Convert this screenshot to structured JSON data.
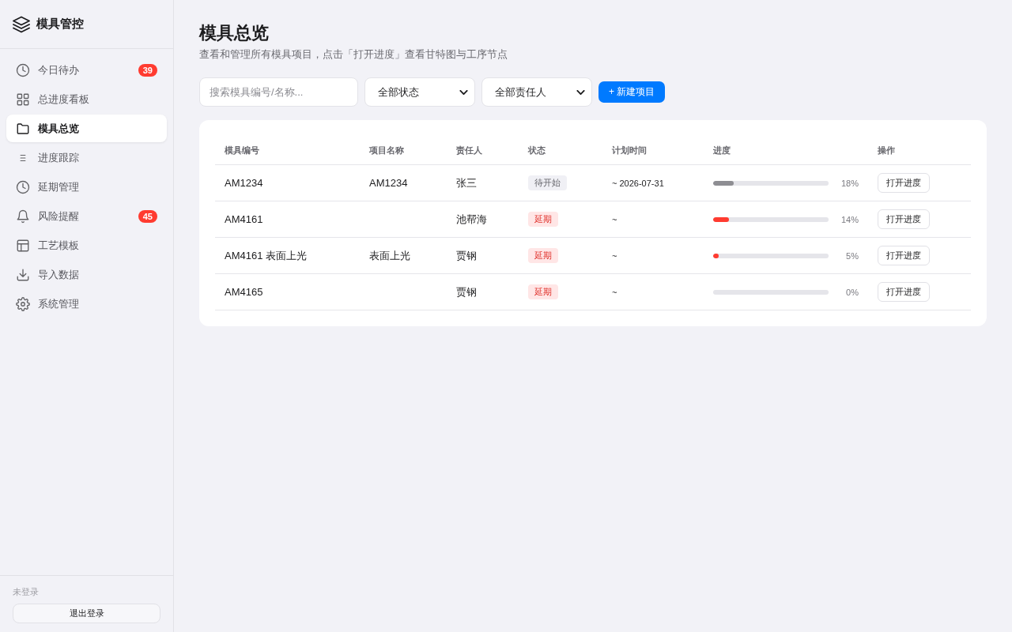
{
  "sidebar": {
    "logo": "模具管控",
    "items": [
      {
        "label": "今日待办",
        "selected": false,
        "badge": "39"
      },
      {
        "label": "总进度看板",
        "selected": false
      },
      {
        "label": "模具总览",
        "selected": true
      },
      {
        "label": "进度跟踪",
        "selected": false
      },
      {
        "label": "延期管理",
        "selected": false
      },
      {
        "label": "风险提醒",
        "selected": false,
        "badge": "45"
      },
      {
        "label": "工艺模板",
        "selected": false
      },
      {
        "label": "导入数据",
        "selected": false
      },
      {
        "label": "系统管理",
        "selected": false
      }
    ],
    "footer": {
      "user_status": "未登录",
      "logout_button": "退出登录"
    }
  },
  "page": {
    "title": "模具总览",
    "subtitle": "查看和管理所有模具项目，点击「打开进度」查看甘特图与工序节点"
  },
  "toolbar": {
    "search": {
      "placeholder": "搜索模具编号/名称..."
    },
    "filters": [
      {
        "value": "全部状态"
      },
      {
        "value": "全部责任人"
      }
    ],
    "new_button": "+ 新建项目"
  },
  "table": {
    "columns": [
      "模具编号",
      "项目名称",
      "责任人",
      "状态",
      "计划时间",
      "进度",
      "操作"
    ],
    "rows": [
      {
        "mold_no": "AM1234",
        "project_name": "AM1234",
        "owner": "张三",
        "status": {
          "label": "待开始",
          "kind": "pending"
        },
        "plan_time": "~ 2026-07-31",
        "progress": {
          "level": 0.18,
          "reading": "18%"
        },
        "action": "打开进度"
      },
      {
        "mold_no": "AM4161",
        "owner": "池帮海",
        "status": {
          "label": "延期",
          "kind": "delayed"
        },
        "plan_time": "~",
        "progress": {
          "level": 0.14,
          "reading": "14%"
        },
        "action": "打开进度"
      },
      {
        "mold_no": "AM4161 表面上光",
        "project_name": "表面上光",
        "owner": "贾钢",
        "status": {
          "label": "延期",
          "kind": "delayed"
        },
        "plan_time": "~",
        "progress": {
          "level": 0.05,
          "reading": "5%"
        },
        "action": "打开进度"
      },
      {
        "mold_no": "AM4165",
        "owner": "贾钢",
        "status": {
          "label": "延期",
          "kind": "delayed"
        },
        "plan_time": "~",
        "progress": {
          "reading": "0%"
        },
        "action": "打开进度"
      }
    ]
  }
}
